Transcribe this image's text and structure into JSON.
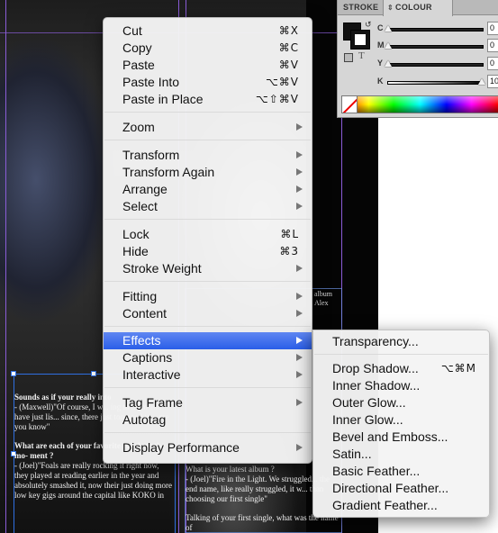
{
  "document": {
    "caption_album": "album\nAlex",
    "left_column": [
      {
        "q": "Sounds as if your really into",
        "a": "- (Maxwell)\"Of course, I w... ing to them and have just lis... since, there just too good to... me you know\""
      },
      {
        "q": "What are each of your favorite bands at the mo- ment ?",
        "a": "- (Joel)\"Foals are really rocking it right now, they played at reading earlier in the year and absolutely smashed it, now their just doing more low key gigs around the capital like KOKO in"
      }
    ],
    "right_column": [
      {
        "q": "What is your latest album ?",
        "a": "- (Joel)\"Fire in the Light. We struggled... the end name, like really struggled, it w... than choosing our first single\""
      },
      {
        "q": "Talking of your first single, what was the name of",
        "a": ""
      }
    ]
  },
  "colour_panel": {
    "tabs": [
      "STROKE",
      "COLOUR"
    ],
    "active_tab": "COLOUR",
    "sliders": [
      {
        "letter": "C",
        "value": "0",
        "position": 0
      },
      {
        "letter": "M",
        "value": "0",
        "position": 0
      },
      {
        "letter": "Y",
        "value": "0",
        "position": 0
      },
      {
        "letter": "K",
        "value": "10",
        "position": 1
      }
    ],
    "fill_color": "#111111",
    "stroke_color": "#111111"
  },
  "context_menu": {
    "items": [
      {
        "label": "Cut",
        "shortcut": "⌘X"
      },
      {
        "label": "Copy",
        "shortcut": "⌘C"
      },
      {
        "label": "Paste",
        "shortcut": "⌘V"
      },
      {
        "label": "Paste Into",
        "shortcut": "⌥⌘V"
      },
      {
        "label": "Paste in Place",
        "shortcut": "⌥⇧⌘V"
      },
      {
        "label": "Zoom",
        "submenu": true
      },
      {
        "label": "Transform",
        "submenu": true
      },
      {
        "label": "Transform Again",
        "submenu": true
      },
      {
        "label": "Arrange",
        "submenu": true
      },
      {
        "label": "Select",
        "submenu": true
      },
      {
        "label": "Lock",
        "shortcut": "⌘L"
      },
      {
        "label": "Hide",
        "shortcut": "⌘3"
      },
      {
        "label": "Stroke Weight",
        "submenu": true
      },
      {
        "label": "Fitting",
        "submenu": true
      },
      {
        "label": "Content",
        "submenu": true
      },
      {
        "label": "Effects",
        "submenu": true,
        "highlighted": true
      },
      {
        "label": "Captions",
        "submenu": true
      },
      {
        "label": "Interactive",
        "submenu": true
      },
      {
        "label": "Tag Frame",
        "submenu": true
      },
      {
        "label": "Autotag"
      },
      {
        "label": "Display Performance",
        "submenu": true
      }
    ]
  },
  "effects_submenu": {
    "items": [
      {
        "label": "Transparency..."
      },
      {
        "label": "Drop Shadow...",
        "shortcut": "⌥⌘M"
      },
      {
        "label": "Inner Shadow..."
      },
      {
        "label": "Outer Glow..."
      },
      {
        "label": "Inner Glow..."
      },
      {
        "label": "Bevel and Emboss..."
      },
      {
        "label": "Satin..."
      },
      {
        "label": "Basic Feather..."
      },
      {
        "label": "Directional Feather..."
      },
      {
        "label": "Gradient Feather..."
      }
    ],
    "highlight_color": "#2a5ee8"
  }
}
